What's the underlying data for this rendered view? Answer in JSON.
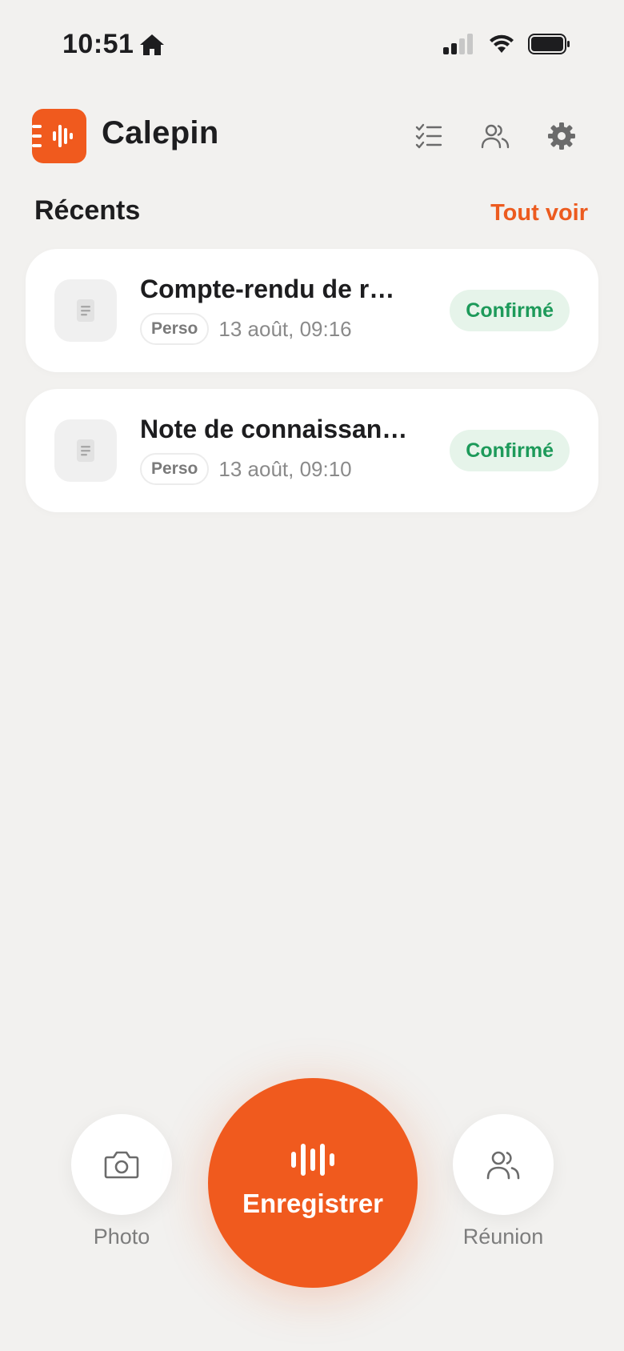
{
  "status_bar": {
    "time": "10:51"
  },
  "header": {
    "app_name": "Calepin"
  },
  "recents": {
    "title": "Récents",
    "see_all": "Tout voir",
    "items": [
      {
        "title": "Compte-rendu de r…",
        "tag": "Perso",
        "date": "13 août, 09:16",
        "status": "Confirmé"
      },
      {
        "title": "Note de connaissan…",
        "tag": "Perso",
        "date": "13 août, 09:10",
        "status": "Confirmé"
      }
    ]
  },
  "actions": {
    "photo_label": "Photo",
    "record_label": "Enregistrer",
    "meeting_label": "Réunion"
  },
  "colors": {
    "accent": "#f05a1e",
    "background": "#f2f1ef",
    "confirmed_bg": "#e6f4ea",
    "confirmed_text": "#1d9a5a"
  }
}
